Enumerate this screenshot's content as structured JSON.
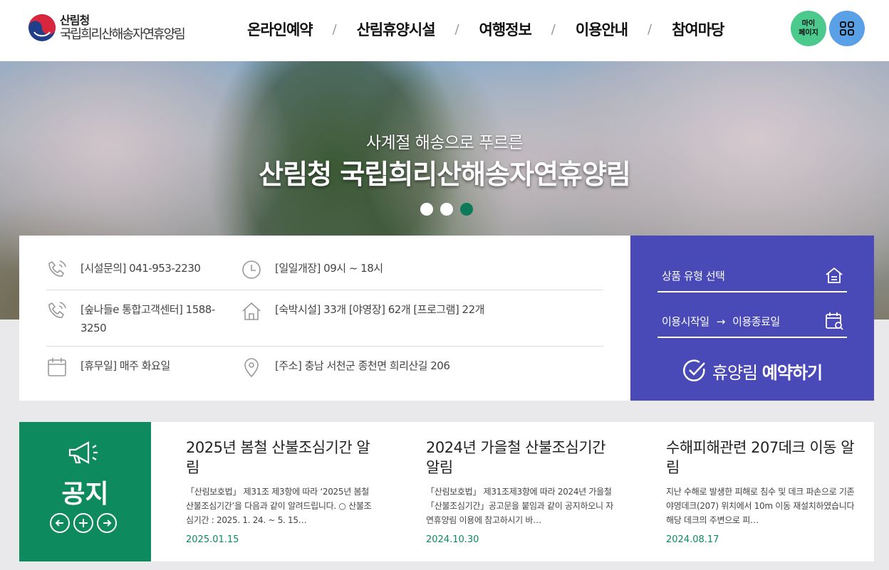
{
  "header": {
    "logo_sub": "산림청",
    "logo_main": "국립희리산해송자연휴양림",
    "nav": [
      "온라인예약",
      "산림휴양시설",
      "여행정보",
      "이용안내",
      "참여마당"
    ],
    "separator": "/",
    "mypage_line1": "마이",
    "mypage_line2": "페이지",
    "menu_icon": "grid-menu-icon"
  },
  "hero": {
    "subtitle": "사계절 해송으로 푸르른",
    "title": "산림청 국립희리산해송자연휴양림",
    "slide_count": 3,
    "active_slide": 3
  },
  "info": {
    "phone": "[시설문의] 041-953-2230",
    "hours": "[일일개장] 09시 ~ 18시",
    "center_line1": "[숲나들e 통합고객센터] 1588-",
    "center_line2": "3250",
    "facilities": "[숙박시설] 33개 [야영장] 62개 [프로그램] 22개",
    "closed": "[휴무일] 매주 화요일",
    "address": "[주소] 충남 서천군 종천면 희리산길 206"
  },
  "reserve": {
    "product_label": "상품 유형 선택",
    "date_start": "이용시작일",
    "arrow": "→",
    "date_end": "이용종료일",
    "button_light": "휴양림",
    "button_bold": "예약하기"
  },
  "notice": {
    "label": "공지",
    "items": [
      {
        "title": "2025년 봄철 산불조심기간 알림",
        "body": "「산림보호법」 제31조 제3항에 따라 ‘2025년 봄철 산불조심기간’을 다음과 같이 알려드립니다. ○ 산불조심기간 : 2025. 1. 24. ~ 5. 15…",
        "date": "2025.01.15"
      },
      {
        "title": "2024년 가을철 산불조심기간알림",
        "body": "「산림보호법」 제31조제3항에 따라 2024년 가을철「산불조심기간」공고문을 붙임과 같이 공지하오니 자연휴양림 이용에 참고하시기 바…",
        "date": "2024.10.30"
      },
      {
        "title": "수해피해관련 207데크 이동 알림",
        "body": "지난 수해로 발생한 피해로 침수 및 데크 파손으로 기존 야영데크(207) 위치에서 10m 이동 재설치하였습니다 해당 데크의 주변으로 피…",
        "date": "2024.08.17"
      }
    ]
  },
  "colors": {
    "notice_green": "#0d8a5e",
    "reserve_purple": "#4a49b8",
    "mypage_green": "#4cc98c",
    "menu_blue": "#5aa0e6"
  }
}
